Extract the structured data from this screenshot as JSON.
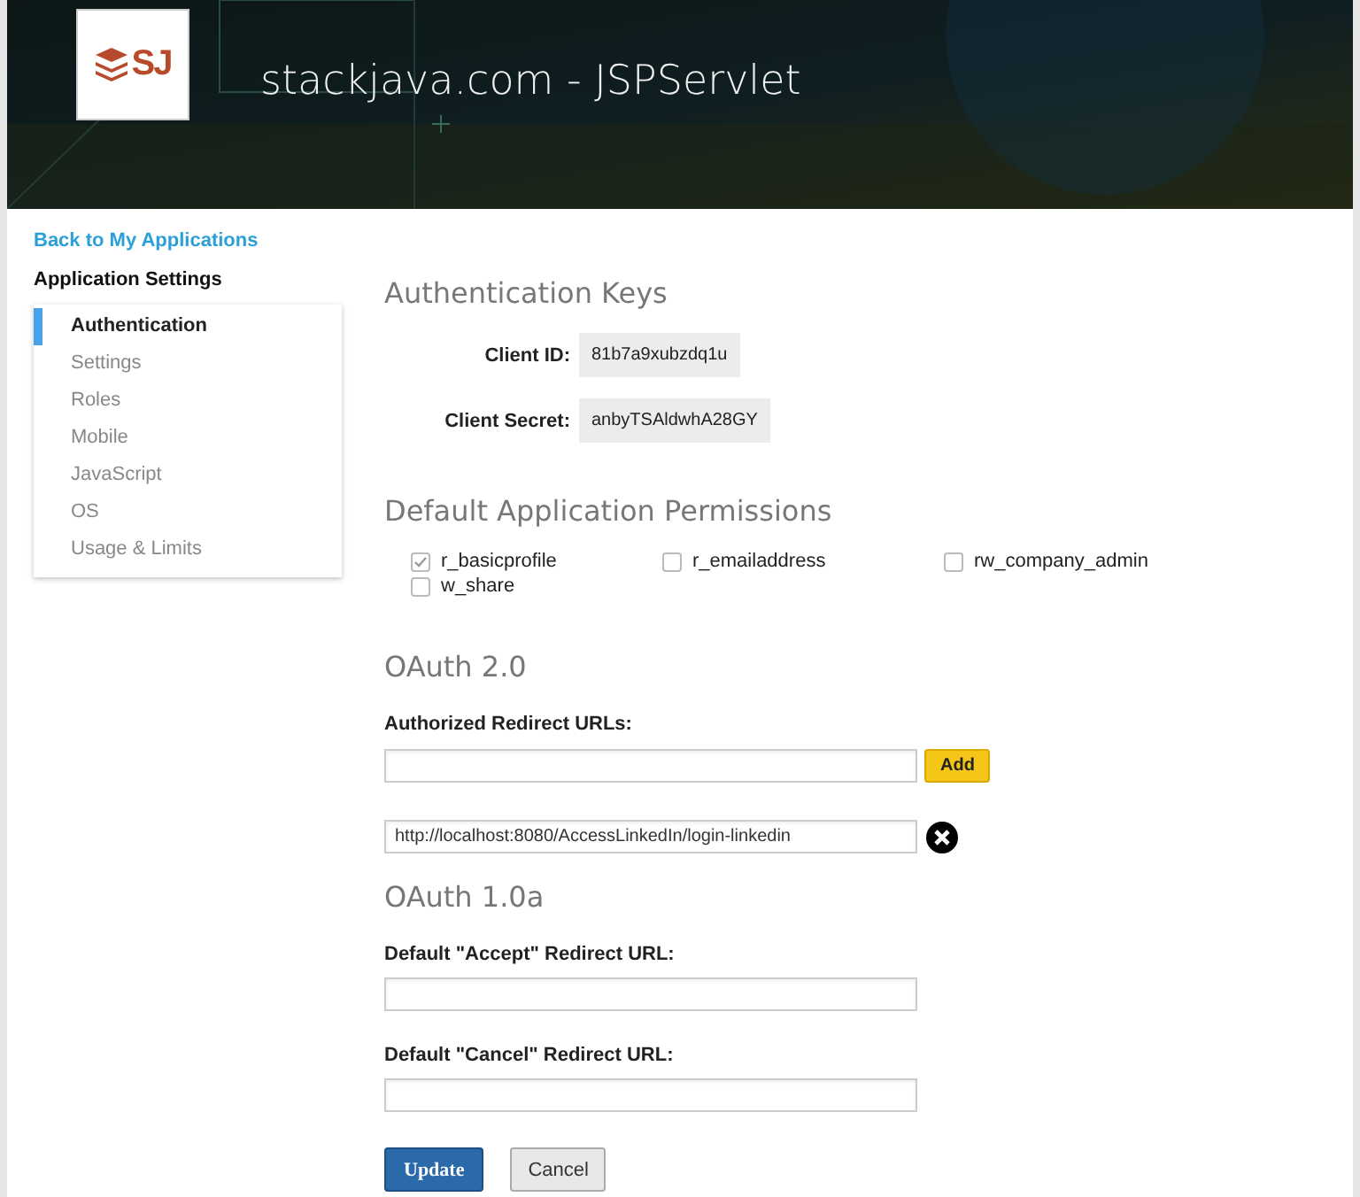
{
  "header": {
    "logo_text": "SJ",
    "title": "stackjava.com - JSPServlet"
  },
  "sidebar": {
    "back_link": "Back to My Applications",
    "heading": "Application Settings",
    "items": [
      {
        "label": "Authentication",
        "selected": true
      },
      {
        "label": "Settings",
        "selected": false
      },
      {
        "label": "Roles",
        "selected": false
      },
      {
        "label": "Mobile",
        "selected": false
      },
      {
        "label": "JavaScript",
        "selected": false
      },
      {
        "label": "OS",
        "selected": false
      },
      {
        "label": "Usage & Limits",
        "selected": false
      }
    ]
  },
  "auth_keys": {
    "heading": "Authentication Keys",
    "fields": [
      {
        "label": "Client ID:",
        "value": "81b7a9xubzdq1u"
      },
      {
        "label": "Client Secret:",
        "value": "anbyTSAldwhA28GY"
      }
    ]
  },
  "permissions": {
    "heading": "Default Application Permissions",
    "items": [
      {
        "label": "r_basicprofile",
        "checked": true
      },
      {
        "label": "r_emailaddress",
        "checked": false
      },
      {
        "label": "rw_company_admin",
        "checked": false
      },
      {
        "label": "w_share",
        "checked": false
      }
    ]
  },
  "oauth2": {
    "heading": "OAuth 2.0",
    "label": "Authorized Redirect URLs:",
    "add_button": "Add",
    "urls": [
      "http://localhost:8080/AccessLinkedIn/login-linkedin"
    ]
  },
  "oauth1": {
    "heading": "OAuth 1.0a",
    "fields": [
      {
        "label": "Default \"Accept\" Redirect URL:"
      },
      {
        "label": "Default \"Cancel\" Redirect URL:"
      }
    ]
  },
  "buttons": {
    "update": "Update",
    "cancel": "Cancel"
  }
}
